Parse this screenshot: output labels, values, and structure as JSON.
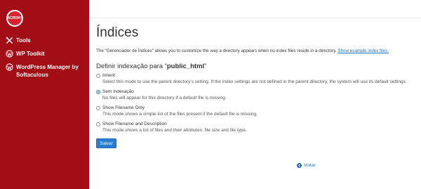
{
  "sidebar": {
    "logo_text": "ACRONY",
    "items": [
      {
        "label": "Tools",
        "icon": "tools-icon"
      },
      {
        "label": "WP Toolkit",
        "icon": "wordpress-icon"
      },
      {
        "label": "WordPress Manager by Softaculous",
        "icon": "wordpress-icon"
      }
    ]
  },
  "main": {
    "title": "Índices",
    "description": "The “Gerenciador de Índices” allows you to customize the way a directory appears when no index files reside in a directory.",
    "description_link": "Show example index files.",
    "section_prefix": "Definir indexação para “",
    "section_dir": "public_html",
    "section_suffix": "”",
    "options": [
      {
        "label": "Inherit",
        "help": "Select this mode to use the parent directory’s setting. If the index settings are not defined in the parent directory, the system will use its default settings.",
        "selected": false
      },
      {
        "label": "Sem indexação",
        "help": "No files will appear for this directory if a default file is missing.",
        "selected": true
      },
      {
        "label": "Show Filename Only",
        "help": "This mode shows a simple list of the files present if the default file is missing.",
        "selected": false
      },
      {
        "label": "Show Filename and Description",
        "help": "This mode shows a list of files and their attributes: file size and file type.",
        "selected": false
      }
    ],
    "save_label": "Salvar",
    "back_label": "Voltar"
  },
  "colors": {
    "sidebar_bg": "#a30d16",
    "accent": "#2b7bd0",
    "link": "#1d6fb6"
  }
}
